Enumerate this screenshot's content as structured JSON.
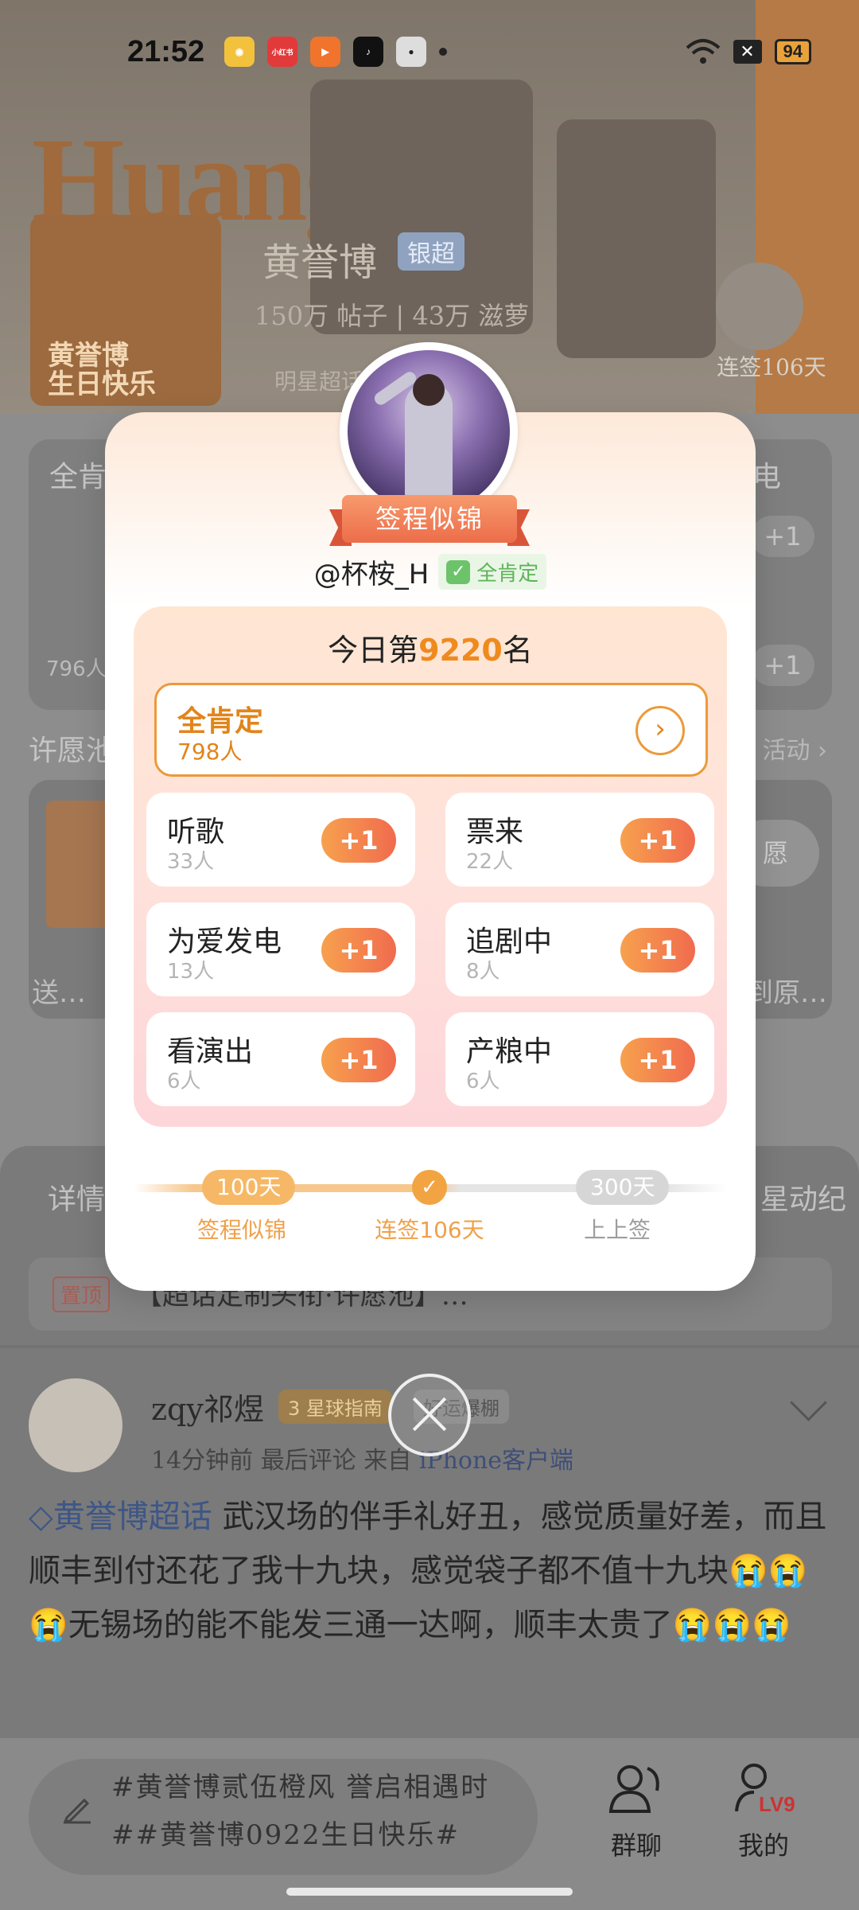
{
  "status_bar": {
    "time": "21:52",
    "apps": [
      "weibo-icon",
      "xiaohongshu-icon",
      "kuaishou-icon",
      "douyin-icon",
      "wechat-icon"
    ],
    "xiaohongshu_label": "小红书",
    "battery": "94"
  },
  "header": {
    "banner_word": "Huang",
    "card_text": "黄誉博\n生日快乐",
    "title": "黄誉博",
    "badge": "银超",
    "stats": "150万 帖子 | 43万 滋萝",
    "sub": "明星超话",
    "sign_days": "连签106天"
  },
  "background": {
    "panel_label": "全肯",
    "panel_right": "电",
    "plus": "+1",
    "count": "796人",
    "wish_title": "许愿池",
    "wish_right": "活动 ›",
    "wish_btn": "愿",
    "wish_send": "送…",
    "wish_send_right": "到原…"
  },
  "feed": {
    "tab_left": "详情",
    "tab_right": "星动纪",
    "pin_tag": "置顶",
    "pin_text": "【超话定制头衔·许愿池】…",
    "post": {
      "user": "zqy祁煜",
      "badge": "3 星球指南",
      "badge2": "好运爆棚",
      "meta_time": "14分钟前 最后评论",
      "meta_from": "来自",
      "meta_client": "iPhone客户端",
      "topic": "黄誉博超话",
      "body": "  武汉场的伴手礼好丑，感觉质量好差，而且顺丰到付还花了我十九块，感觉袋子都不值十九块😭😭😭无锡场的能不能发三通一达啊，顺丰太贵了😭😭😭"
    }
  },
  "bottom_bar": {
    "comment_placeholder": "#黄誉博贰伍橙风 誉启相遇时##黄誉博0922生日快乐#",
    "group_chat": "群聊",
    "mine": "我的",
    "level": "LV9"
  },
  "modal": {
    "title_badge": "签程似锦",
    "handle": "@杯桉_H",
    "tag": "全肯定",
    "rank_prefix": "今日第",
    "rank_num": "9220",
    "rank_suffix": "名",
    "main_option": {
      "label": "全肯定",
      "count": "798人"
    },
    "options": [
      {
        "label": "听歌",
        "count": "33人",
        "plus": "+1"
      },
      {
        "label": "票来",
        "count": "22人",
        "plus": "+1"
      },
      {
        "label": "为爱发电",
        "count": "13人",
        "plus": "+1"
      },
      {
        "label": "追剧中",
        "count": "8人",
        "plus": "+1"
      },
      {
        "label": "看演出",
        "count": "6人",
        "plus": "+1"
      },
      {
        "label": "产粮中",
        "count": "6人",
        "plus": "+1"
      }
    ],
    "progress": {
      "milestone1": "100天",
      "milestone1_label": "签程似锦",
      "current_label": "连签106天",
      "milestone2": "300天",
      "milestone2_label": "上上签"
    }
  },
  "colors": {
    "accent_orange": "#ef8a1f",
    "plus_gradient_start": "#f7a14e",
    "plus_gradient_end": "#f06b4e",
    "tag_green": "#5eb358"
  }
}
